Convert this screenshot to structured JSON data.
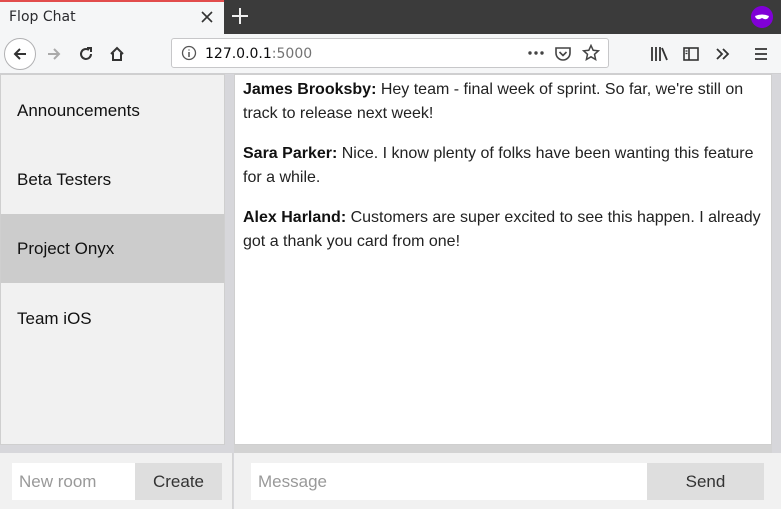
{
  "browser": {
    "tab_title": "Flop Chat",
    "url_host": "127.0.0.1",
    "url_port": ":5000"
  },
  "sidebar": {
    "rooms": [
      {
        "label": "Announcements",
        "active": false
      },
      {
        "label": "Beta Testers",
        "active": false
      },
      {
        "label": "Project Onyx",
        "active": true
      },
      {
        "label": "Team iOS",
        "active": false
      }
    ]
  },
  "messages": [
    {
      "author": "James Brooksby:",
      "text": " Hey team - final week of sprint. So far, we're still on track to release next week!"
    },
    {
      "author": "Sara Parker:",
      "text": " Nice. I know plenty of folks have been wanting this feature for a while."
    },
    {
      "author": "Alex Harland:",
      "text": " Customers are super excited to see this happen. I already got a thank you card from one!"
    }
  ],
  "footer": {
    "room_placeholder": "New room",
    "create_label": "Create",
    "message_placeholder": "Message",
    "send_label": "Send"
  },
  "colors": {
    "active_room": "#cccccc",
    "private_badge": "#8000d7",
    "tab_accent": "#e24c4c"
  }
}
